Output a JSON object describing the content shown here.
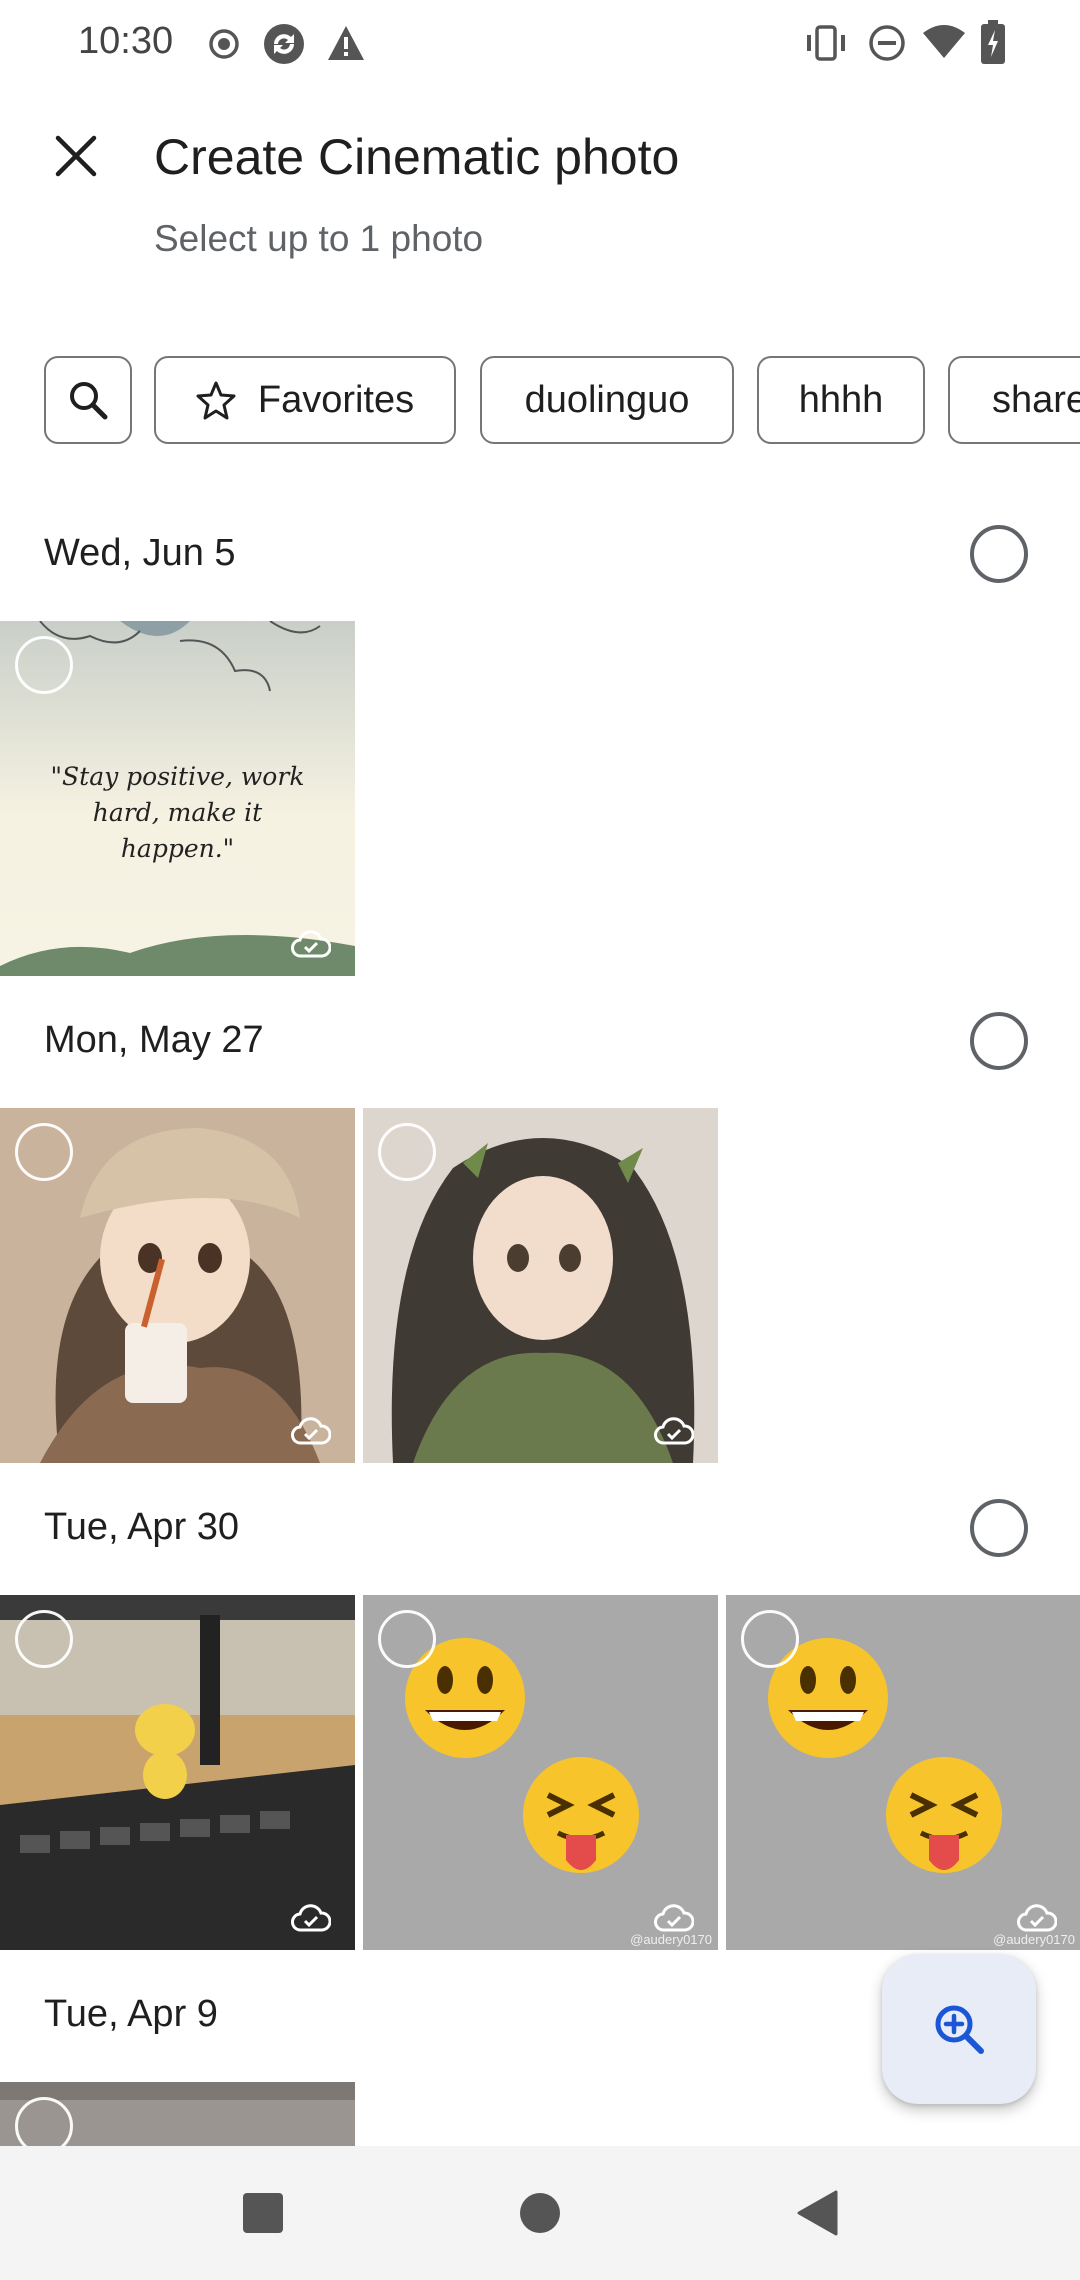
{
  "status_bar": {
    "time": "10:30",
    "left_icons": [
      "record-icon",
      "sync-icon",
      "warning-icon"
    ],
    "right_icons": [
      "vibrate-icon",
      "do-not-disturb-icon",
      "wifi-icon",
      "battery-charging-icon"
    ]
  },
  "header": {
    "close_icon": "close-icon",
    "title": "Create Cinematic photo",
    "subtitle": "Select up to 1 photo"
  },
  "filter_chips": {
    "search_icon": "search-icon",
    "items": [
      {
        "label": "Favorites",
        "icon": "star-icon"
      },
      {
        "label": "duolinguo"
      },
      {
        "label": "hhhh"
      },
      {
        "label": "share"
      }
    ]
  },
  "sections": [
    {
      "date": "Wed, Jun 5",
      "photos": [
        {
          "caption": "\"Stay positive, work hard, make it happen.\"",
          "cloud": "cloud-done-icon"
        }
      ]
    },
    {
      "date": "Mon, May 27",
      "photos": [
        {
          "cloud": "cloud-done-icon"
        },
        {
          "cloud": "cloud-done-icon"
        }
      ]
    },
    {
      "date": "Tue, Apr 30",
      "photos": [
        {
          "cloud": "cloud-done-icon"
        },
        {
          "cloud": "cloud-done-icon",
          "watermark": "@audery0170"
        },
        {
          "cloud": "cloud-done-icon",
          "watermark": "@audery0170"
        }
      ]
    },
    {
      "date": "Tue, Apr 9",
      "photos": [
        {}
      ]
    }
  ],
  "fab": {
    "icon": "zoom-in-icon"
  },
  "nav_bar": {
    "icons": [
      "recents-square-icon",
      "home-circle-icon",
      "back-triangle-icon"
    ]
  },
  "colors": {
    "accent": "#1a56d6",
    "fab_bg": "#e7ecf7",
    "outline": "#747775"
  }
}
